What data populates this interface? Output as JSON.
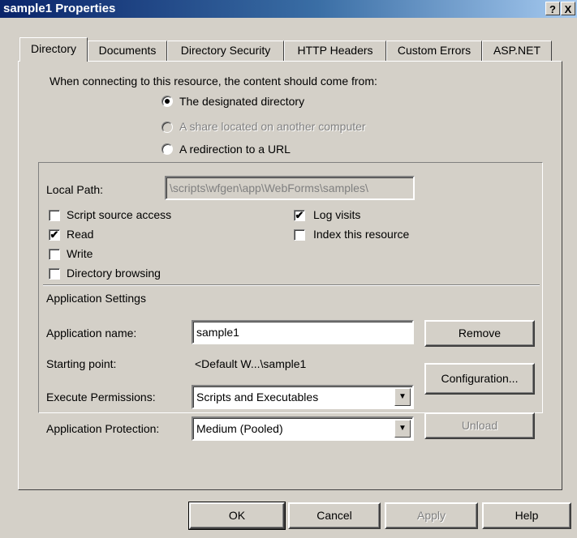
{
  "window": {
    "title": "sample1 Properties",
    "help_label": "?",
    "close_label": "X"
  },
  "tabs": [
    {
      "label": "Directory"
    },
    {
      "label": "Documents"
    },
    {
      "label": "Directory Security"
    },
    {
      "label": "HTTP Headers"
    },
    {
      "label": "Custom Errors"
    },
    {
      "label": "ASP.NET"
    }
  ],
  "content_source": {
    "prompt": "When connecting to this resource, the content should come from:",
    "options": [
      {
        "label": "The designated directory",
        "selected": true,
        "disabled": false
      },
      {
        "label": "A share located on another computer",
        "selected": false,
        "disabled": true
      },
      {
        "label": "A redirection to a URL",
        "selected": false,
        "disabled": false
      }
    ]
  },
  "local_path": {
    "label": "Local Path:",
    "value": "\\scripts\\wfgen\\app\\WebForms\\samples\\"
  },
  "checkboxes": {
    "script_source_access": {
      "label": "Script source access",
      "checked": false
    },
    "read": {
      "label": "Read",
      "checked": true
    },
    "write": {
      "label": "Write",
      "checked": false
    },
    "directory_browsing": {
      "label": "Directory browsing",
      "checked": false
    },
    "log_visits": {
      "label": "Log visits",
      "checked": true
    },
    "index_resource": {
      "label": "Index this resource",
      "checked": false
    }
  },
  "check_mark": "✔",
  "app_settings": {
    "heading": "Application Settings",
    "name_label": "Application name:",
    "name_value": "sample1",
    "remove_label": "Remove",
    "starting_point_label": "Starting point:",
    "starting_point_value": "<Default W...\\sample1",
    "configuration_label": "Configuration...",
    "execute_label": "Execute Permissions:",
    "execute_value": "Scripts and Executables",
    "protection_label": "Application Protection:",
    "protection_value": "Medium (Pooled)",
    "unload_label": "Unload",
    "dropdown_arrow": "▼"
  },
  "footer": {
    "ok_label": "OK",
    "cancel_label": "Cancel",
    "apply_label": "Apply",
    "help_label": "Help"
  }
}
